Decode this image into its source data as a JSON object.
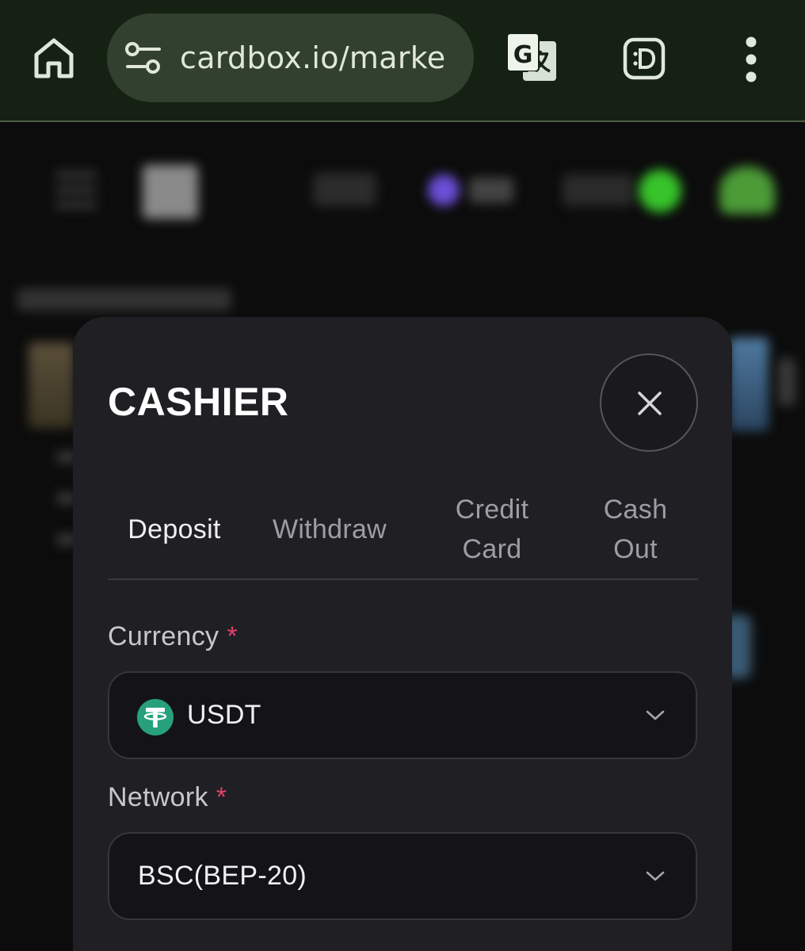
{
  "browser": {
    "url": "cardbox.io/marke",
    "icons": {
      "home": "home-icon",
      "site_settings": "tune-icon",
      "translate": "translate-icon",
      "extension": "extension-icon",
      "menu": "more-vert-icon"
    }
  },
  "cashier": {
    "title": "CASHIER",
    "tabs": [
      {
        "label": "Deposit",
        "active": true
      },
      {
        "label": "Withdraw",
        "active": false
      },
      {
        "label": "Credit Card",
        "active": false
      },
      {
        "label": "Cash Out",
        "active": false
      }
    ],
    "currency": {
      "label": "Currency",
      "required_mark": "*",
      "value": "USDT",
      "icon": "tether-icon"
    },
    "network": {
      "label": "Network",
      "required_mark": "*",
      "value": "BSC(BEP-20)"
    }
  },
  "colors": {
    "chrome_bg": "#152113",
    "urlbar_bg": "#324030",
    "modal_bg": "#202024",
    "required": "#e2406b",
    "tether": "#26a17b"
  }
}
